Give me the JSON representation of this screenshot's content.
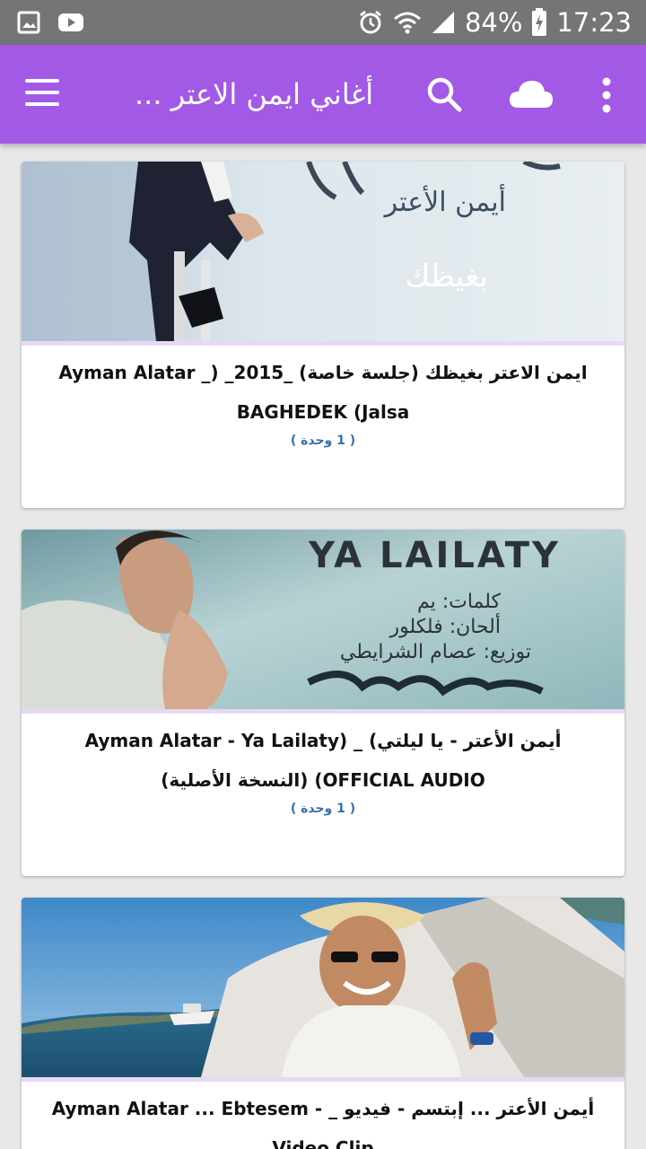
{
  "status_bar": {
    "battery": "84%",
    "time": "17:23",
    "icons": [
      "gallery-icon",
      "youtube-icon",
      "alarm-icon",
      "wifi-icon",
      "signal-icon",
      "battery-charging-icon"
    ]
  },
  "app_bar": {
    "title": "أغاني ايمن الاعتر ...",
    "icons": [
      "menu-icon",
      "search-icon",
      "cloud-icon",
      "more-vert-icon"
    ],
    "color": "#a25ae6"
  },
  "cards": [
    {
      "title": "ايمن الاعتر بغيظك (جلسة خاصة) _2015_ (Ayman Alatar _ BAGHEDEK (Jalsa",
      "count": "( 1 وحدة )",
      "thumb": {
        "text_1": "أيمن الأعتر",
        "text_2": "بغيظك"
      }
    },
    {
      "title": "أيمن الأعتر - يا ليلتي) _ (Ayman Alatar - Ya Lailaty (OFFICIAL AUDIO (النسخة الأصلية)",
      "count": "( 1 وحدة )",
      "thumb": {
        "heading": "YA LAILATY",
        "line_1": "كلمات: يم",
        "line_2": "ألحان: فلكلور",
        "line_3": "توزيع: عصام الشرايطي"
      }
    },
    {
      "title": "أيمن الأعتر ... إبتسم - فيديو _ Ayman Alatar ... Ebtesem - Video Clip",
      "count": "",
      "thumb": {}
    }
  ]
}
